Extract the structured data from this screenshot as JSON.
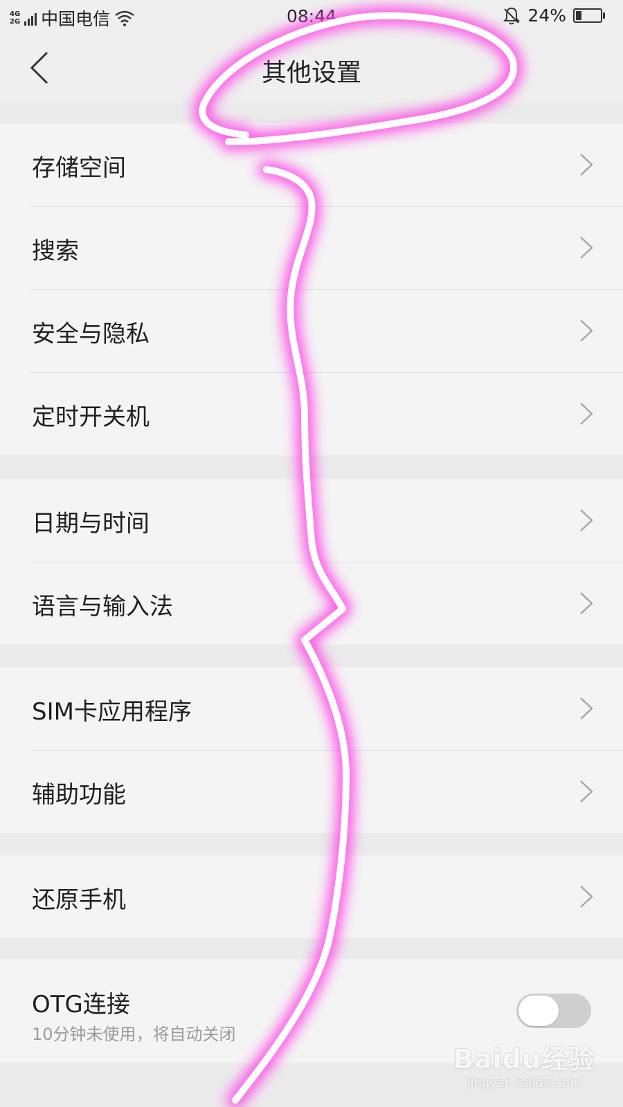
{
  "status_bar": {
    "network_top": "4G",
    "network_bottom": "2G",
    "carrier": "中国电信",
    "time": "08:44",
    "battery": "24%",
    "battery_level": 0.24
  },
  "nav": {
    "title": "其他设置"
  },
  "groups": [
    {
      "items": [
        {
          "label": "存储空间"
        },
        {
          "label": "搜索"
        },
        {
          "label": "安全与隐私"
        },
        {
          "label": "定时开关机"
        }
      ]
    },
    {
      "items": [
        {
          "label": "日期与时间"
        },
        {
          "label": "语言与输入法"
        }
      ]
    },
    {
      "items": [
        {
          "label": "SIM卡应用程序"
        },
        {
          "label": "辅助功能"
        }
      ]
    },
    {
      "items": [
        {
          "label": "还原手机"
        }
      ]
    }
  ],
  "otg": {
    "label": "OTG连接",
    "subtitle": "10分钟未使用，将自动关闭",
    "enabled": false
  },
  "watermark": {
    "logo": "Baidu经验",
    "url": "jingyan.baidu.com"
  },
  "colors": {
    "annotation_stroke": "#ffffff",
    "annotation_glow": "#ff40e6"
  }
}
